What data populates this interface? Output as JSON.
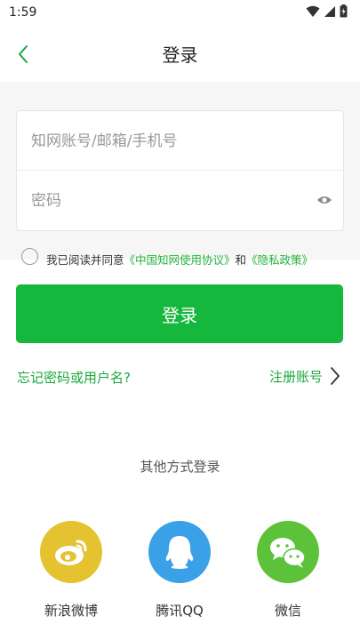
{
  "status_bar": {
    "time": "1:59"
  },
  "header": {
    "title": "登录"
  },
  "form": {
    "account_placeholder": "知网账号/邮箱/手机号",
    "password_placeholder": "密码"
  },
  "agreement": {
    "prefix": "我已阅读并同意",
    "terms_link": "《中国知网使用协议》",
    "conjunction": "和",
    "privacy_link": "《隐私政策》"
  },
  "login_button": "登录",
  "forgot_link": "忘记密码或用户名?",
  "register_link": "注册账号",
  "other_login": {
    "label": "其他方式登录",
    "options": [
      {
        "label": "新浪微博",
        "icon": "weibo-icon",
        "color": "#e5c22f"
      },
      {
        "label": "腾讯QQ",
        "icon": "qq-icon",
        "color": "#3aa1e8"
      },
      {
        "label": "微信",
        "icon": "wechat-icon",
        "color": "#5cc23a"
      }
    ]
  },
  "colors": {
    "accent": "#16b73d",
    "link": "#1aa83a",
    "form_bg": "#f6f6f6"
  }
}
